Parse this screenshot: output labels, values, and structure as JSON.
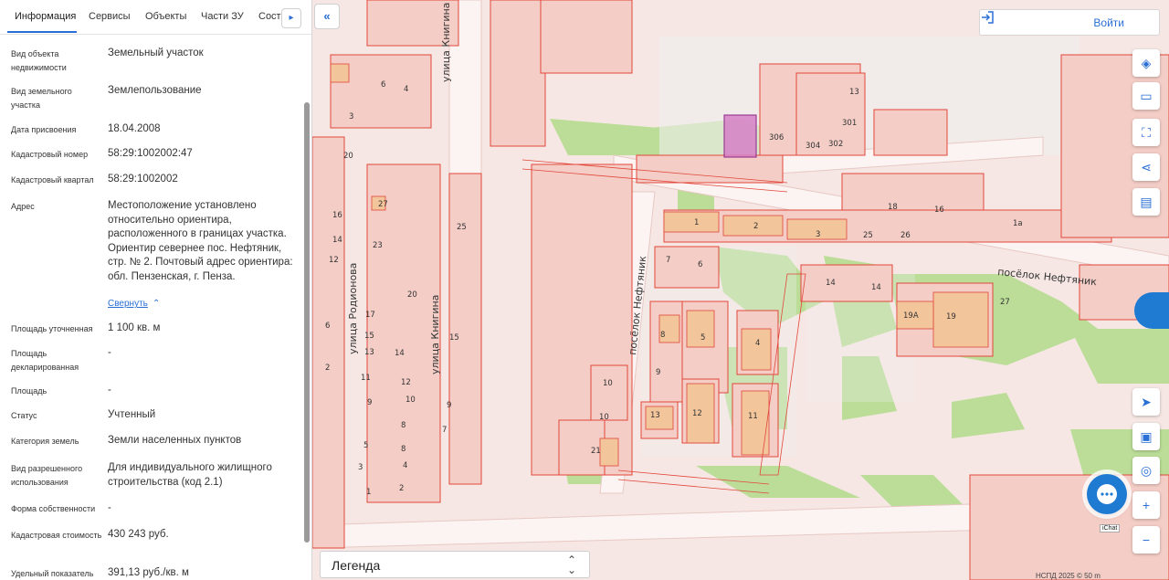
{
  "tabs": [
    "Информация",
    "Сервисы",
    "Объекты",
    "Части ЗУ",
    "Соста"
  ],
  "details": [
    {
      "label": "Вид объекта недвижимости",
      "value": "Земельный участок"
    },
    {
      "label": "Вид земельного участка",
      "value": "Землепользование"
    },
    {
      "label": "Дата присвоения",
      "value": "18.04.2008"
    },
    {
      "label": "Кадастровый номер",
      "value": "58:29:1002002:47"
    },
    {
      "label": "Кадастровый квартал",
      "value": "58:29:1002002"
    },
    {
      "label": "Адрес",
      "value": "Местоположение установлено относительно ориентира, расположенного в границах участка. Ориентир севернее пос. Нефтяник, стр. № 2. Почтовый адрес ориентира: обл. Пензенская, г. Пенза."
    },
    {
      "label": "Площадь уточненная",
      "value": "1 100 кв. м"
    },
    {
      "label": "Площадь декларированная",
      "value": "-"
    },
    {
      "label": "Площадь",
      "value": "-"
    },
    {
      "label": "Статус",
      "value": "Учтенный"
    },
    {
      "label": "Категория земель",
      "value": "Земли населенных пунктов"
    },
    {
      "label": "Вид разрешенного использования",
      "value": "Для индивидуального жилищного строительства (код 2.1)"
    },
    {
      "label": "Форма собственности",
      "value": "-"
    },
    {
      "label": "Кадастровая стоимость",
      "value": "430 243 руб."
    },
    {
      "label": "Удельный показатель",
      "value": "391,13 руб./кв. м"
    }
  ],
  "collapse_label": "Свернуть",
  "login_label": "Войти",
  "legend_label": "Легенда",
  "chat_label": "iChat",
  "scale_text": "НСПД 2025 ©   50 m",
  "roads": [
    "улица Книгина",
    "улица Родионова",
    "улица Книгина",
    "посёлок Нефтяник",
    "посёлок Нефтяник"
  ],
  "lot_numbers": [
    "13",
    "301",
    "306",
    "304",
    "302",
    "1",
    "2",
    "3",
    "18",
    "16",
    "25",
    "26",
    "1а",
    "6",
    "4",
    "3",
    "20",
    "27",
    "25",
    "16",
    "14",
    "23",
    "20",
    "17",
    "12",
    "15",
    "6",
    "15",
    "13",
    "14",
    "2",
    "11",
    "12",
    "10",
    "9",
    "9",
    "7",
    "8",
    "8",
    "5",
    "4",
    "3",
    "2",
    "1",
    "7",
    "6",
    "14",
    "14",
    "27",
    "19А",
    "19",
    "8",
    "5",
    "4",
    "9",
    "10",
    "13",
    "12",
    "11",
    "10",
    "21"
  ],
  "colors": {
    "accent": "#2a6fd6",
    "parcel_stroke": "#e2473a",
    "parcel_fill": "#f5d5cf",
    "building": "#f2c59b",
    "green": "#a6d57e",
    "selected": "#d781c7"
  }
}
